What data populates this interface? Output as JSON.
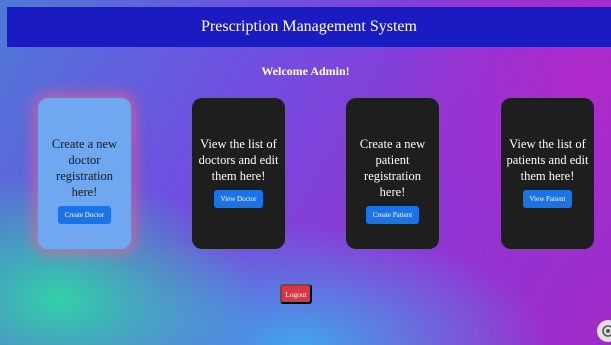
{
  "header": {
    "title": "Prescription Management System"
  },
  "welcome": "Welcome Admin!",
  "cards": [
    {
      "text": "Create a new doctor registration here!",
      "button": "Create Doctor"
    },
    {
      "text": "View the list of doctors and edit them here!",
      "button": "View Doctor"
    },
    {
      "text": "Create a new patient registration here!",
      "button": "Create Patient"
    },
    {
      "text": "View the list of patients and edit them here!",
      "button": "View Patient"
    }
  ],
  "logout": "Logout",
  "colors": {
    "header_bg": "#1b1bc2",
    "card_bg": "#1e1e1e",
    "card_highlight_bg": "#6fa8f0",
    "primary_button": "#1a73e8",
    "logout_button": "#dc3545"
  },
  "icons": {
    "corner": "helper-widget-icon"
  }
}
